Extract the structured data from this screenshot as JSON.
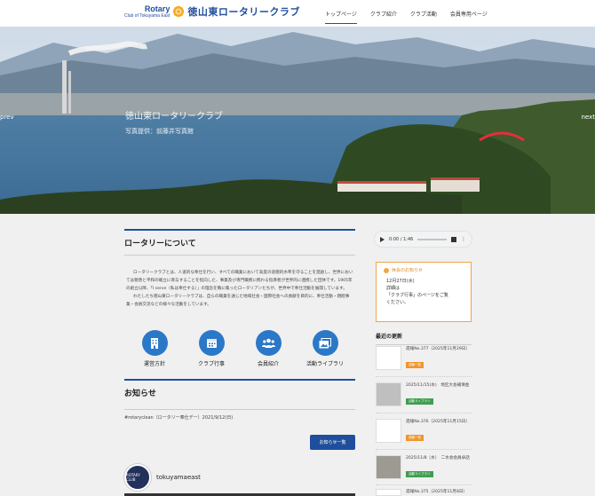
{
  "header": {
    "logo_en": "Rotary",
    "logo_sub": "Club of Tokuyama East",
    "logo_jp": "徳山東ロータリークラブ",
    "nav": [
      "トップページ",
      "クラブ紹介",
      "クラブ活動",
      "会員専用ページ"
    ]
  },
  "hero": {
    "title": "徳山東ロータリークラブ",
    "credit": "写真提供：前藤井写真館",
    "prev": "prev",
    "next": "next"
  },
  "about": {
    "title": "ロータリーについて",
    "paragraphs": [
      "ロータリークラブとは、人道的な奉仕を行い、すべての職業において高度の道徳的水準を守ることを奨励し、世界においては親善と平和の確立に寄与することを指向した、事業及び専門職務に携わる指導者が世界的に連携した団体です。1905年の創立以降、「I serve（私は奉仕する）」の理念を胸に集ったロータリアンたちが、世界中で奉仕活動を展開しています。",
      "わたしたち徳山東ロータリークラブは、自らの職業を通じた地域社会・国際社会への貢献を目的に、奉仕活動・親睦事業・会員交流などの様々な活動をしています。"
    ],
    "icons": [
      {
        "label": "運営方針",
        "icon": "building-icon"
      },
      {
        "label": "クラブ行事",
        "icon": "calendar-icon"
      },
      {
        "label": "会員紹介",
        "icon": "people-icon"
      },
      {
        "label": "活動ライブラリ",
        "icon": "gallery-icon"
      }
    ]
  },
  "news": {
    "title": "お知らせ",
    "items": [
      "#rotaryclean（ロータリー奉仕デー）2021/9/12(日)"
    ],
    "button": "お知らせ一覧"
  },
  "instagram": {
    "name": "tokuyamaeast",
    "avatar_text": "ROTARY CLUB"
  },
  "audio": {
    "time": "0:00 / 1:46"
  },
  "notice": {
    "title": "休会のお知らせ",
    "lines": [
      "12月27日(水)",
      "詳細は",
      "「クラブ行事」のページをご覧",
      "ください。"
    ]
  },
  "updates": {
    "title": "最近の更新",
    "items": [
      {
        "text": "週報No.377（2025年11月29日）",
        "tag": "週報一覧",
        "tag_color": "#f0962c"
      },
      {
        "text": "2025/11/15(水)　地区大会補填金",
        "tag": "活動ライブラリ",
        "tag_color": "#3e9e4f"
      },
      {
        "text": "週報No.376（2025年11月15日）",
        "tag": "週報一覧",
        "tag_color": "#f0962c"
      },
      {
        "text": "2025/11/8（水）　二水会会員卓話",
        "tag": "活動ライブラリ",
        "tag_color": "#3e9e4f"
      },
      {
        "text": "週報No.375（2025年11月8日）",
        "tag": "",
        "tag_color": "#f0962c"
      }
    ]
  }
}
